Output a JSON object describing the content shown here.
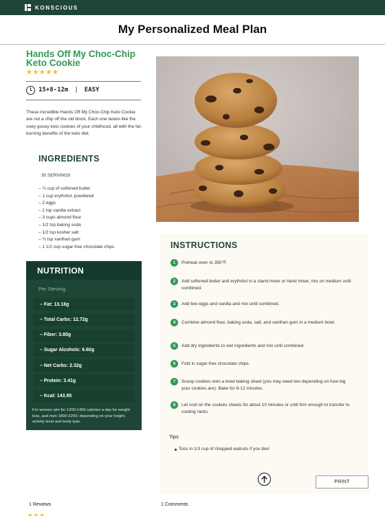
{
  "brand": {
    "name": "KONSCIOUS"
  },
  "page": {
    "title": "My Personalized Meal Plan"
  },
  "recipe": {
    "title": "Hands Off My Choc-Chip Keto Cookie",
    "rating_stars": "★★★★★",
    "time": "15+8-12m",
    "difficulty": "EASY",
    "description": "These incredible Hands Off My Choc-Chip Keto Cookie are not a chip off the old block. Each one tastes like the ooey gooey keto cookies of your childhood, all with the fat-burning benefits of the keto diet."
  },
  "ingredients": {
    "heading": "INGREDIENTS",
    "servings": "30 SERVINGS",
    "items": [
      "– ¾ cup of softened butter",
      "– 1 cup erythritol, powdered",
      "– 2 eggs",
      "– 2 tsp  vanilla extract",
      "– 3 cups almond flour",
      "– 1/2 tsp baking soda",
      "– 1/2 tsp kosher salt",
      "– ¾ tsp xanthan gum",
      "– 1 1/2 cup sugar-free chocolate chips"
    ]
  },
  "nutrition": {
    "heading": "NUTRITION",
    "per_serving": "Per Serving",
    "rows": [
      "– Fat: 13.18g",
      "– Total Carbs: 12.72g",
      "– Fiber: 3.80g",
      "– Sugar Alcohols: 6.60g",
      "– Net Carbs: 2.32g",
      "– Protein: 3.41g",
      "– Kcal: 143.95"
    ],
    "footnote": "For women aim for 1200-1400 calories a day for weight loss, and men 1800-2200; depending on your height, activity level and body type."
  },
  "instructions": {
    "heading": "INSTRUCTIONS",
    "steps": [
      {
        "num": "1",
        "text": "Preheat oven to 350°F."
      },
      {
        "num": "2",
        "text": "Add softened butter and erythritol in a stand mixer or hand mixer, mix on medium until combined."
      },
      {
        "num": "3",
        "text": "Add two eggs and vanilla and mix until combined."
      },
      {
        "num": "4",
        "text": "Combine almond flour, baking soda, salt, and xanthan gum in a medium bowl."
      },
      {
        "num": "5",
        "text": "Add dry ingredients to wet ingredients and mix until combined."
      },
      {
        "num": "6",
        "text": "Fold in sugar-free chocolate chips."
      },
      {
        "num": "7",
        "text": "Scoop cookies onto a lined baking sheet (you may need two depending on how big your cookies are). Bake for 8-12 minutes."
      },
      {
        "num": "8",
        "text": "Let cool on the cookies sheets for about 10 minutes or until firm enough to transfer to cooling racks."
      }
    ],
    "tips_heading": "Tips",
    "tip": "Toss in 1/3 cup of chopped walnuts if you like!"
  },
  "actions": {
    "print_label": "PRINT"
  },
  "footer": {
    "reviews": "1 Reviews",
    "comments": "1 Comments",
    "stars": "★★★"
  },
  "colors": {
    "brand_green": "#1e4536",
    "accent_green": "#2f9b4f",
    "star": "#f4c20d"
  },
  "icons": {
    "logo": "konscious-logo-icon",
    "clock": "clock-icon",
    "up": "arrow-up-icon"
  }
}
